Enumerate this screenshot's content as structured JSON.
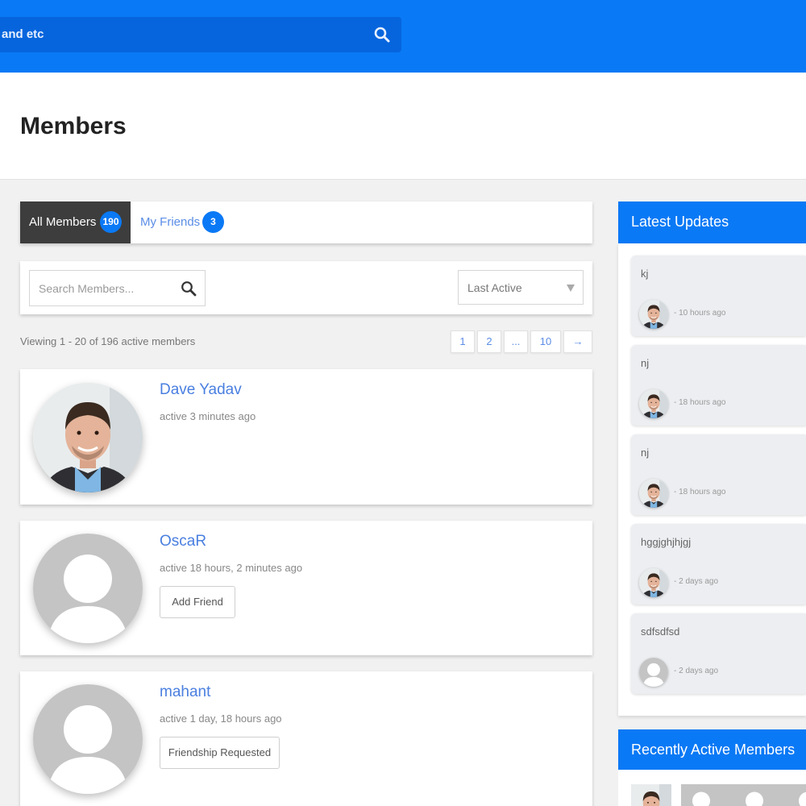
{
  "header": {
    "search_text": "and etc",
    "search_icon": "search-icon"
  },
  "page": {
    "title": "Members"
  },
  "tabs": [
    {
      "label": "All Members",
      "count": "190",
      "active": true
    },
    {
      "label": "My Friends",
      "count": "3",
      "active": false
    }
  ],
  "filter": {
    "search_placeholder": "Search Members...",
    "order_by": "Last Active"
  },
  "listing": {
    "viewing_text": "Viewing 1 - 20 of 196 active members",
    "pages": [
      "1",
      "2",
      "...",
      "10",
      "→"
    ]
  },
  "members": [
    {
      "name": "Dave Yadav",
      "active": "active 3 minutes ago",
      "button": "",
      "avatar": "photo"
    },
    {
      "name": "OscaR",
      "active": "active 18 hours, 2 minutes ago",
      "button": "Add Friend",
      "avatar": "default"
    },
    {
      "name": "mahant",
      "active": "active 1 day, 18 hours ago",
      "button": "Friendship Requested",
      "avatar": "default"
    }
  ],
  "sidebar": {
    "latest_updates_title": "Latest Updates",
    "updates": [
      {
        "text": "kj",
        "time": "- 10 hours ago",
        "avatar": "photo"
      },
      {
        "text": "nj",
        "time": "- 18 hours ago",
        "avatar": "photo"
      },
      {
        "text": "nj",
        "time": "- 18 hours ago",
        "avatar": "photo"
      },
      {
        "text": "hggjghjhjgj",
        "time": "- 2 days ago",
        "avatar": "photo"
      },
      {
        "text": "sdfsdfsd",
        "time": "- 2 days ago",
        "avatar": "default"
      }
    ],
    "recent_title": "Recently Active Members"
  },
  "colors": {
    "brand_blue": "#0a79f5",
    "link_blue": "#4a7fe0",
    "dark_tab": "#3d3d3d"
  }
}
